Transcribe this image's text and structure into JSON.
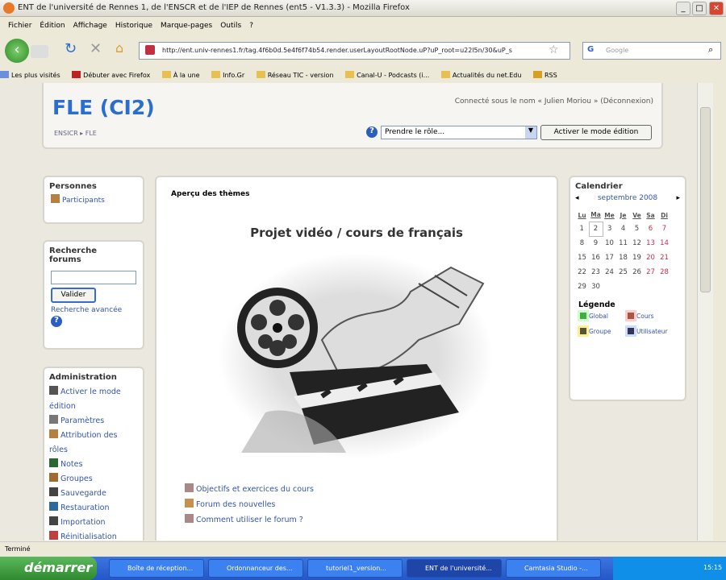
{
  "window": {
    "title": "ENT de l'université de Rennes 1, de l'ENSCR et de l'IEP de Rennes (ent5 - V1.3.3) - Mozilla Firefox"
  },
  "menu": [
    "Fichier",
    "Édition",
    "Affichage",
    "Historique",
    "Marque-pages",
    "Outils",
    "?"
  ],
  "address": {
    "url": "http://ent.univ-rennes1.fr/tag.4f6b0d.5e4f6f74b54.render.userLayoutRootNode.uP?uP_root=u22l5n/30&uP_s",
    "search_placeholder": "Google"
  },
  "bookmarks": [
    "Les plus visités",
    "Débuter avec Firefox",
    "À la une",
    "Info.Gr",
    "Réseau TIC - version",
    "Canal-U - Podcasts (i...",
    "Actualités du net.Edu",
    "RSS"
  ],
  "header": {
    "course_title": "FLE (CI2)",
    "login_text": "Connecté sous le nom « Julien Moriou » (Déconnexion)",
    "breadcrumb": [
      "ENSICR",
      "FLE"
    ],
    "role_select": "Prendre le rôle...",
    "edit_button": "Activer le mode édition"
  },
  "blocks": {
    "people": {
      "title": "Personnes",
      "items": [
        "Participants"
      ]
    },
    "search": {
      "title": "Recherche forums",
      "button": "Valider",
      "advanced": "Recherche avancée"
    },
    "admin": {
      "title": "Administration",
      "items": [
        "Activer le mode édition",
        "Paramètres",
        "Attribution des rôles",
        "Notes",
        "Groupes",
        "Sauvegarde",
        "Restauration",
        "Importation",
        "Réinitialisation"
      ]
    }
  },
  "main": {
    "section_title": "Aperçu des thèmes",
    "heading": "Projet vidéo / cours de français",
    "links": [
      "Objectifs et exercices du cours",
      "Forum des nouvelles",
      "Comment utiliser le forum ?"
    ]
  },
  "calendar": {
    "title": "Calendrier",
    "month": "septembre 2008",
    "days": [
      "Lu",
      "Ma",
      "Me",
      "Je",
      "Ve",
      "Sa",
      "Di"
    ],
    "weeks": [
      [
        "1",
        "2",
        "3",
        "4",
        "5",
        "6",
        "7"
      ],
      [
        "8",
        "9",
        "10",
        "11",
        "12",
        "13",
        "14"
      ],
      [
        "15",
        "16",
        "17",
        "18",
        "19",
        "20",
        "21"
      ],
      [
        "22",
        "23",
        "24",
        "25",
        "26",
        "27",
        "28"
      ],
      [
        "29",
        "30",
        "",
        "",
        "",
        "",
        ""
      ]
    ],
    "legend_title": "Légende",
    "legend": [
      "Global",
      "Cours",
      "Groupe",
      "Utilisateur"
    ]
  },
  "status": "Terminé",
  "taskbar": {
    "start": "démarrer",
    "tasks": [
      "Boîte de réception...",
      "Ordonnanceur des...",
      "tutoriel1_version...",
      "ENT de l'université...",
      "Camtasia Studio -..."
    ],
    "clock": "15:15"
  }
}
